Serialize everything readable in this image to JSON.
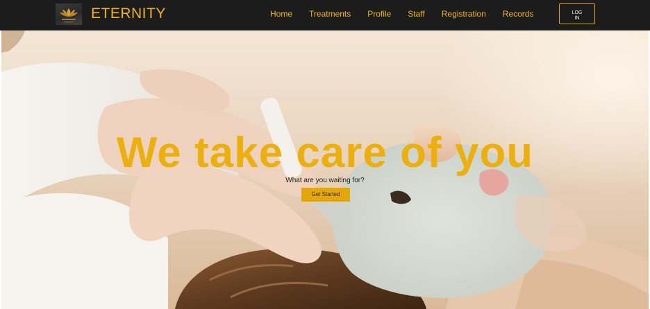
{
  "colors": {
    "navbar_bg": "#1c1c1c",
    "accent": "#f0b418",
    "headline": "#ebb00f",
    "cta_bg": "#e3a70c"
  },
  "brand": {
    "name": "ETERNITY",
    "logo_icon": "lotus-logo-icon"
  },
  "nav": {
    "links": [
      "Home",
      "Treatments",
      "Profile",
      "Staff",
      "Registration",
      "Records"
    ],
    "login_label": "LOG IN"
  },
  "hero": {
    "headline": "We take care of you",
    "subtitle": "What are you waiting for?",
    "cta_label": "Get Started",
    "background_image": "facial-treatment-photo"
  }
}
